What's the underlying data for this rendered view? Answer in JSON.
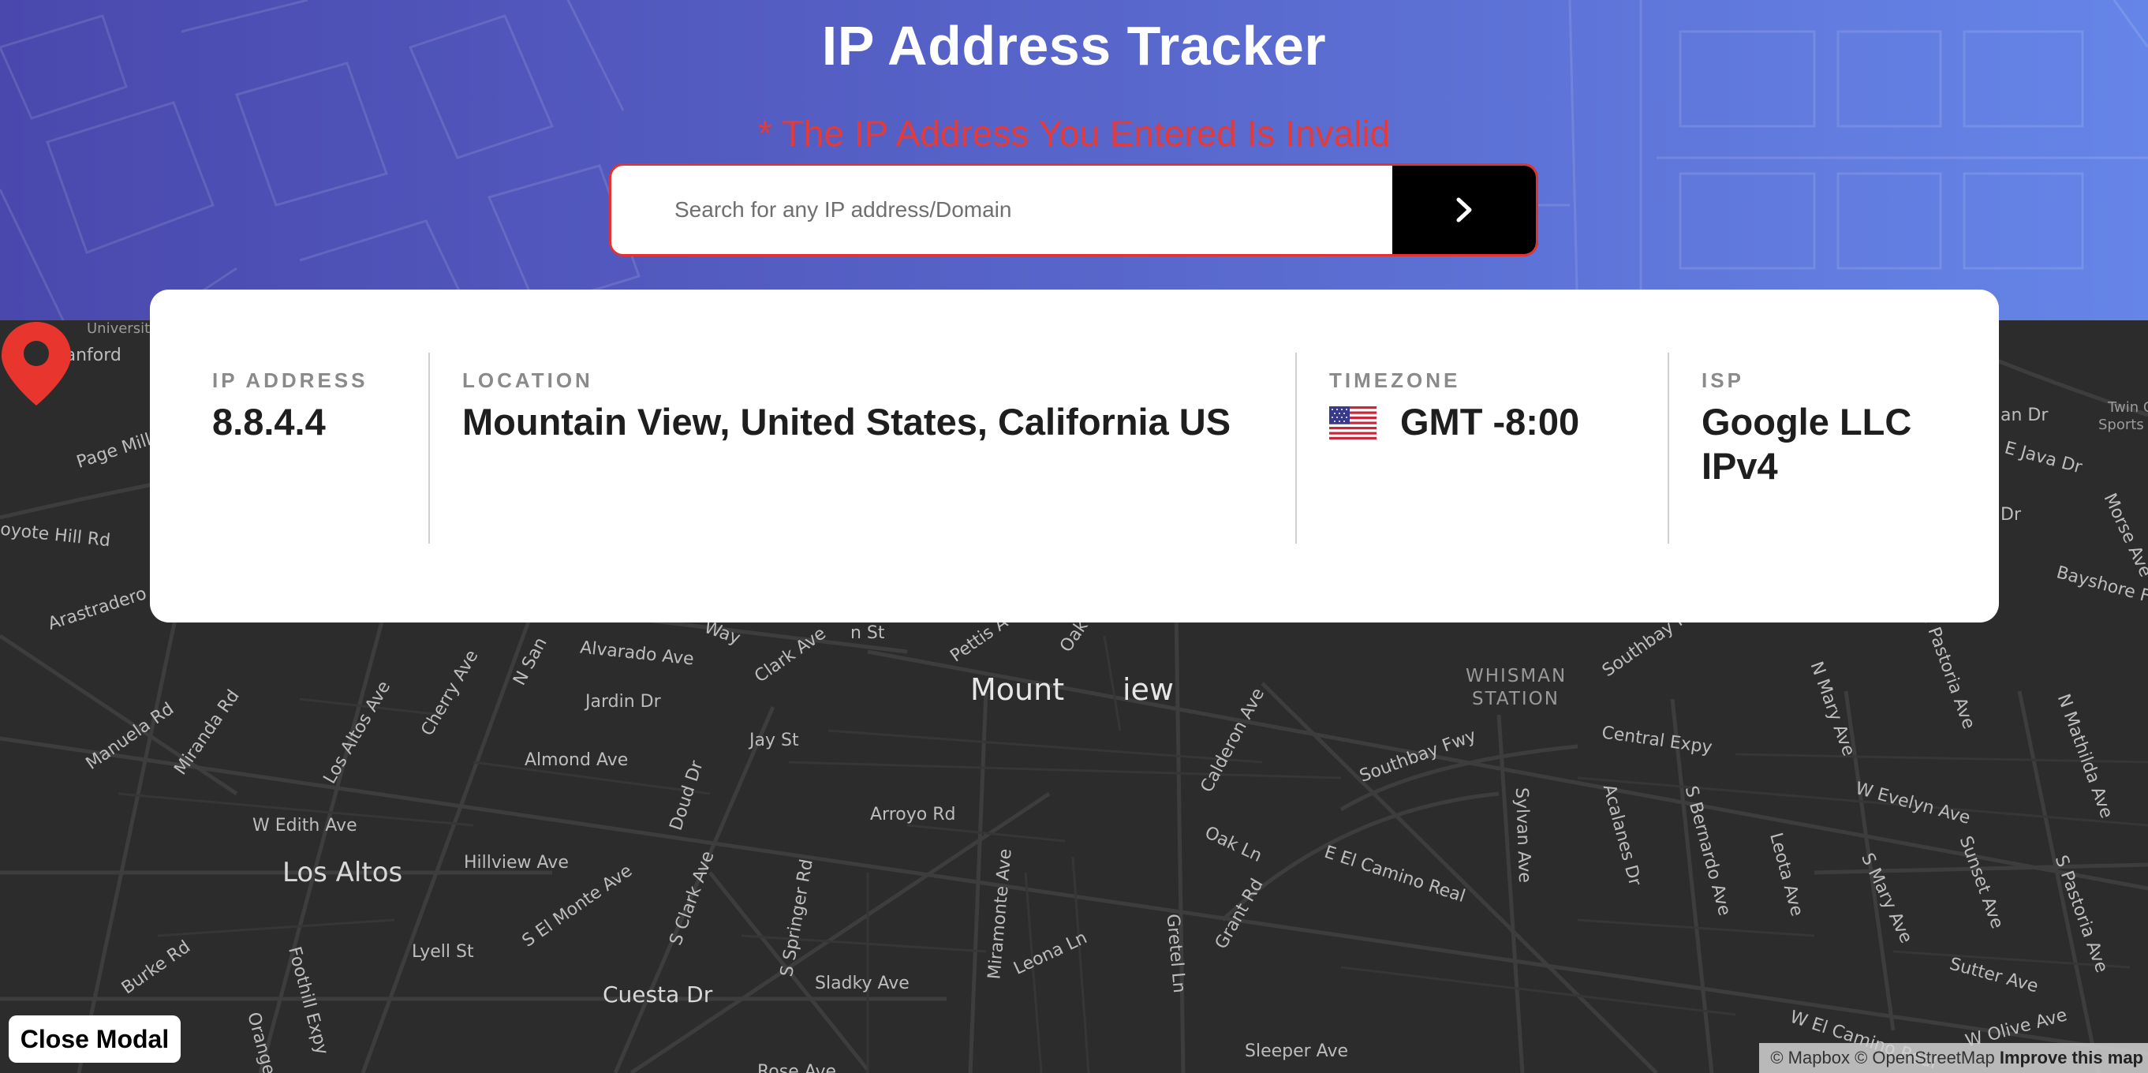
{
  "header": {
    "title": "IP Address Tracker",
    "error_message": "* The IP Address You Entered Is Invalid",
    "search": {
      "placeholder": "Search for any IP address/Domain",
      "value": ""
    },
    "submit_icon": "chevron-right-icon"
  },
  "info": {
    "ip": {
      "label": "IP ADDRESS",
      "value": "8.8.4.4"
    },
    "location": {
      "label": "LOCATION",
      "value": "Mountain View, United States, California US"
    },
    "timezone": {
      "label": "TIMEZONE",
      "value": "GMT -8:00",
      "flag_icon": "us-flag-icon"
    },
    "isp": {
      "label": "ISP",
      "line1": "Google LLC",
      "line2": "IPv4"
    }
  },
  "map": {
    "labels": {
      "university": "University",
      "stanford": "Stanford",
      "page_mill": "Page Mill R",
      "coyote_hill": "oyote Hill Rd",
      "arastradero": "Arastradero R",
      "manuela": "Manuela Rd",
      "miranda": "Miranda Rd",
      "los_altos_ave": "Los Altos Ave",
      "cherry": "Cherry Ave",
      "n_san": "N San",
      "alvarado": "Alvarado Ave",
      "clark": "Clark Ave",
      "way": "Way",
      "st": "n St",
      "pettis": "Pettis A",
      "oak": "Oak",
      "jardin": "Jardin Dr",
      "jay": "Jay St",
      "almond": "Almond Ave",
      "doud": "Doud Dr",
      "arroyo": "Arroyo Rd",
      "w_edith": "W Edith Ave",
      "los_altos": "Los Altos",
      "hillview": "Hillview Ave",
      "s_el_monte": "S El Monte Ave",
      "s_clark": "S Clark Ave",
      "s_springer": "S Springer Rd",
      "miramonte": "Miramonte Ave",
      "lyell": "Lyell St",
      "burke": "Burke Rd",
      "foothill": "Foothill Expy",
      "orange": "Orange A",
      "cuesta": "Cuesta Dr",
      "sladky": "Sladky Ave",
      "leona": "Leona Ln",
      "gretel": "Gretel Ln",
      "grant": "Grant Rd",
      "oak_ln": "Oak Ln",
      "calderon": "Calderon Ave",
      "mountain_view_a": "Mount",
      "mountain_view_b": "iew",
      "whisman": "WHISMAN",
      "station": "STATION",
      "southbay_1": "Southbay Fwy",
      "southbay_2": "Southbay Fwy",
      "central": "Central Expy",
      "e_el_camino": "E El Camino Real",
      "w_el_camino": "W El Camino Real",
      "sylvan": "Sylvan Ave",
      "acalanes": "Acalanes Dr",
      "s_bernardo": "S Bernardo Ave",
      "leota": "Leota Ave",
      "s_mary": "S Mary Ave",
      "sunset": "Sunset Ave",
      "s_pastoria": "S Pastoria Ave",
      "n_mary": "N Mary Ave",
      "n_pastoria": "N Pastoria Ave",
      "n_mathilda": "N Mathilda Ave",
      "w_evelyn": "W Evelyn Ave",
      "sutter": "Sutter Ave",
      "w_olive": "W Olive Ave",
      "sleeper": "Sleeper Ave",
      "rose": "Rose Ave",
      "twin_1": "Twin C",
      "twin_2": "Sports C",
      "e_java": "E Java Dr",
      "an_dr": "an Dr",
      "dr": "Dr",
      "morse": "Morse Ave",
      "bayshore": "Bayshore Fw"
    },
    "marker_icon": "map-pin-icon",
    "attribution": {
      "mapbox": "© Mapbox",
      "osm": "© OpenStreetMap",
      "improve": "Improve this map"
    }
  },
  "close_modal_label": "Close Modal",
  "colors": {
    "accent_error": "#e23b3b",
    "header_start": "#4a48ad",
    "header_end": "#6685e8",
    "marker": "#e8352d"
  }
}
